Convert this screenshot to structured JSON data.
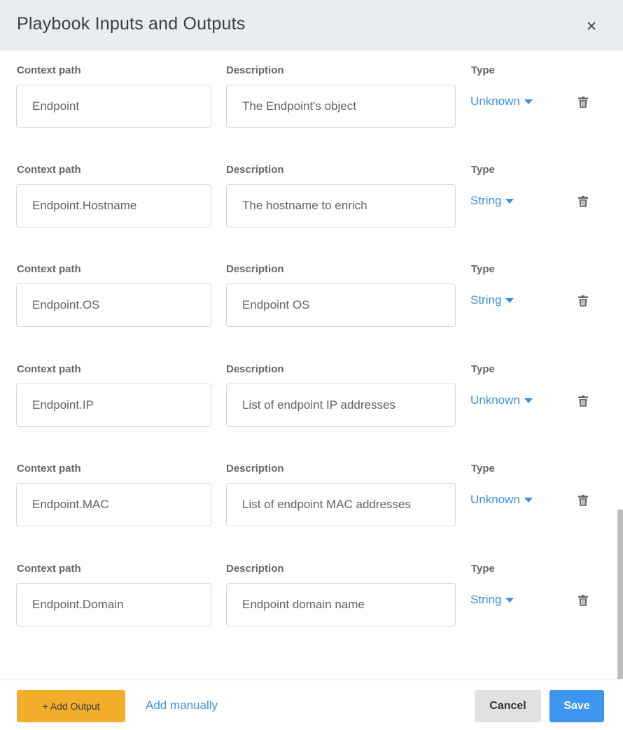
{
  "dialog": {
    "title": "Playbook Inputs and Outputs"
  },
  "labels": {
    "context_path": "Context path",
    "description": "Description",
    "type": "Type"
  },
  "outputs": [
    {
      "context_path": "Endpoint",
      "description": "The Endpoint's object",
      "type": "Unknown"
    },
    {
      "context_path": "Endpoint.Hostname",
      "description": "The hostname to enrich",
      "type": "String"
    },
    {
      "context_path": "Endpoint.OS",
      "description": "Endpoint OS",
      "type": "String"
    },
    {
      "context_path": "Endpoint.IP",
      "description": "List of endpoint IP addresses",
      "type": "Unknown"
    },
    {
      "context_path": "Endpoint.MAC",
      "description": "List of endpoint MAC addresses",
      "type": "Unknown"
    },
    {
      "context_path": "Endpoint.Domain",
      "description": "Endpoint domain name",
      "type": "String"
    }
  ],
  "footer": {
    "add_output_label": "+ Add Output",
    "add_manually_label": "Add manually",
    "cancel_label": "Cancel",
    "save_label": "Save"
  },
  "colors": {
    "accent_link": "#3d8fe0",
    "add_button": "#f2ae2b",
    "save_button": "#3d95f0",
    "header_bg": "#e9edf0"
  }
}
